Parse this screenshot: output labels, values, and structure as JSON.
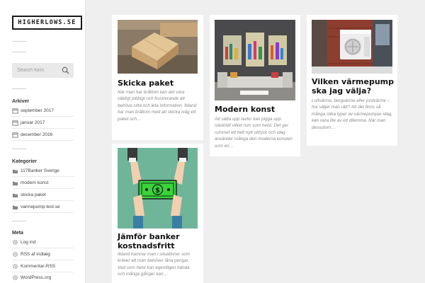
{
  "site": {
    "logo": "HIGHERLOWS.SE"
  },
  "search": {
    "placeholder": "Search form"
  },
  "archive": {
    "title": "Arkiver",
    "items": [
      "september 2017",
      "januar 2017",
      "december 2016"
    ]
  },
  "categories": {
    "title": "Kategorier",
    "items": [
      "117Banker Sverige",
      "modern konst",
      "skicka paket",
      "varmepump-test.se"
    ]
  },
  "meta": {
    "title": "Meta",
    "items": [
      "Log ind",
      "RSS af indlæg",
      "Kommentar-RSS",
      "WordPress.org"
    ]
  },
  "posts": [
    {
      "title": "Skicka paket",
      "excerpt": "När man har bråttom kan det vara väldigt jobbigt och frustrerande att behöva sitta och leta information. Ibland har man bråttom med att skicka iväg ett paket och…"
    },
    {
      "title": "Modern konst",
      "excerpt": "Att sätta upp tavlor kan pigga upp nästintill vilket rum som helst. Det ger rummet ett helt nytt uttryck och idag använder många den moderna konsten som en…"
    },
    {
      "title": "Vilken värmepump ska jag välja?",
      "excerpt": "Luftvärme, bergvärme eller jordvärme – hur väljer man rätt? Att det finns så många olika typer av värmepumpar idag, kan vara lite av ett dilemma. När man dessutom…"
    },
    {
      "title": "Jämför banker kostnadsfritt",
      "excerpt": "Ibland hamnar man i situationer som kräver att man behöver låna pengar. Vad som helst kan egentligen hända och många gånger kan…"
    }
  ],
  "colors": {
    "sidebar_bg": "#ffffff",
    "page_bg": "#efefef",
    "money_bg": "#6fb59a",
    "money_note": "#37d43a"
  }
}
